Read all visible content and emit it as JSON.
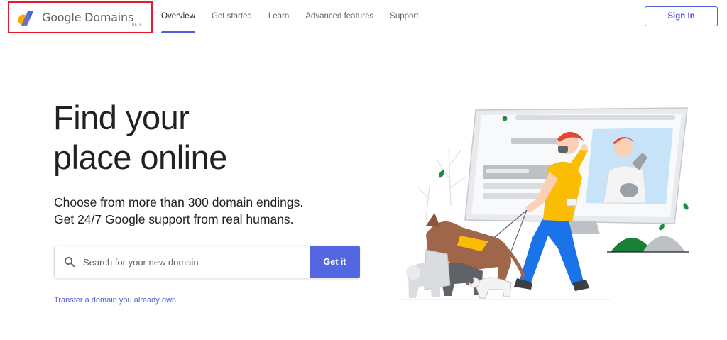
{
  "header": {
    "brand": {
      "name": "Google Domains",
      "badge": "BETA",
      "logo_icon": "google-domains-logo-icon"
    },
    "nav": [
      {
        "label": "Overview",
        "active": true
      },
      {
        "label": "Get started",
        "active": false
      },
      {
        "label": "Learn",
        "active": false
      },
      {
        "label": "Advanced features",
        "active": false
      },
      {
        "label": "Support",
        "active": false
      }
    ],
    "signin_label": "Sign In"
  },
  "hero": {
    "headline_line1": "Find your",
    "headline_line2": "place online",
    "subline1": "Choose from more than 300 domain endings.",
    "subline2": "Get 24/7 Google support from real humans.",
    "search": {
      "placeholder": "Search for your new domain",
      "value": "",
      "icon": "search-icon",
      "button_label": "Get it"
    },
    "transfer_link": "Transfer a domain you already own",
    "illustration": "person-walking-dogs-with-monitor-illustration"
  },
  "colors": {
    "accent": "#4f5fd6",
    "button_blue": "#5367e0",
    "highlight_border": "#e8182c",
    "text_primary": "#202124",
    "text_secondary": "#5f6368"
  }
}
